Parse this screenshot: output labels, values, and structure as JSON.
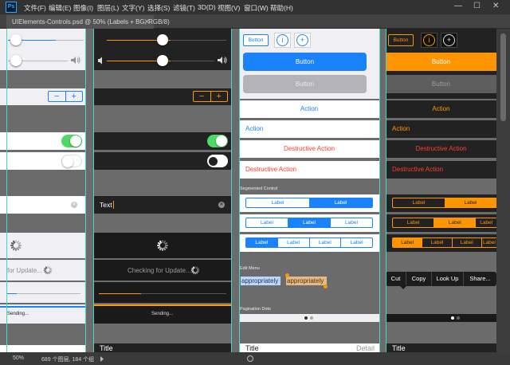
{
  "app": {
    "logo": "Ps"
  },
  "menu": [
    "文件(F)",
    "编辑(E)",
    "图像(I)",
    "图层(L)",
    "文字(Y)",
    "选择(S)",
    "滤镜(T)",
    "3D(D)",
    "视图(V)",
    "窗口(W)",
    "帮助(H)"
  ],
  "window_controls": {
    "minimize": "—",
    "maximize": "☐",
    "close": "✕"
  },
  "tab": {
    "title": "UIElements-Controls.psd @ 50% (Labels + BG, RGB/8)",
    "close": "✕"
  },
  "status": {
    "zoom": "50%",
    "info": "689 个图层, 184 个组"
  },
  "colors": {
    "blue": "#1a82fb",
    "orange": "#ff9500",
    "red": "#ff3b30",
    "guide": "#3fd9c9",
    "green": "#4cd964"
  },
  "col1": {
    "spinner_text": "for Update...",
    "sending": "Sending..."
  },
  "col2": {
    "search_text": "Text",
    "checking": "Checking for Update...",
    "sending": "Sending...",
    "title": "Title",
    "stepper_minus": "−",
    "stepper_plus": "+"
  },
  "col3": {
    "button_small": "Button",
    "button_filled": "Button",
    "button_disabled": "Button",
    "action1": "Action",
    "action2": "Action",
    "destructive1": "Destructive Action",
    "destructive2": "Destructive Action",
    "segmented_header": "Segmented Control",
    "seg_labels": [
      "Label",
      "Label",
      "Label",
      "Label",
      "Label",
      "Label",
      "Label",
      "Label"
    ],
    "edit_menu_header": "Edit Menu",
    "edit_word1": "appropriately",
    "edit_word2": "appropriately",
    "pagination_header": "Pagination Dots",
    "title": "Title",
    "detail": "Detail",
    "info_icon": "i",
    "add_icon": "+"
  },
  "col4": {
    "button_small": "Button",
    "button_filled": "Button",
    "button_disabled": "Button",
    "action1": "Action",
    "action2": "Action",
    "destructive1": "Destructive Action",
    "destructive2": "Destructive Action",
    "seg_labels": [
      "Label",
      "Label",
      "Label",
      "Label",
      "Label",
      "Label",
      "Label",
      "Label",
      "Label",
      "Label"
    ],
    "menu_items": [
      "Cut",
      "Copy",
      "Look Up",
      "Share..."
    ],
    "title": "Title",
    "info_icon": "i",
    "add_icon": "+"
  }
}
